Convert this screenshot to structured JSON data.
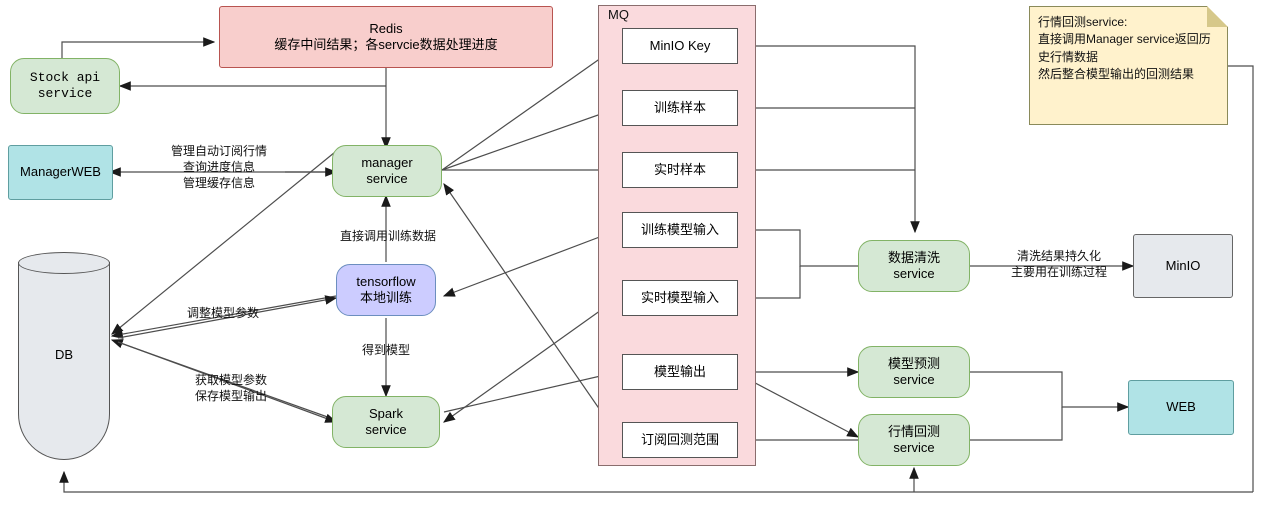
{
  "diagram": {
    "title": "Stock ML platform architecture",
    "colors": {
      "green": "#d5e8d4",
      "cyan": "#b0e3e6",
      "purple": "#ccccff",
      "pink": "#f8cecc",
      "mq_fill": "#fadadd",
      "grey": "#e6e9ed",
      "note": "#fff2cc",
      "stroke": "#666666"
    }
  },
  "nodes": {
    "redis": {
      "label": "Redis\n缓存中间结果；各servcie数据处理进度"
    },
    "stock_api": {
      "label": "Stock api\nservice"
    },
    "manager_web": {
      "label": "ManagerWEB"
    },
    "manager_service": {
      "label": "manager\nservice"
    },
    "db": {
      "label": "DB"
    },
    "tensorflow": {
      "label": "tensorflow\n本地训练"
    },
    "spark": {
      "label": "Spark\nservice"
    },
    "data_clean": {
      "label": "数据清洗\nservice"
    },
    "minio": {
      "label": "MinIO"
    },
    "model_predict": {
      "label": "模型预测\nservice"
    },
    "market_backtest": {
      "label": "行情回测\nservice"
    },
    "web": {
      "label": "WEB"
    }
  },
  "mq": {
    "title": "MQ",
    "queues": [
      {
        "label": "MinIO Key"
      },
      {
        "label": "训练样本"
      },
      {
        "label": "实时样本"
      },
      {
        "label": "训练模型输入"
      },
      {
        "label": "实时模型输入"
      },
      {
        "label": "模型输出"
      },
      {
        "label": "订阅回测范围"
      }
    ]
  },
  "note": {
    "text": "行情回测service:\n直接调用Manager service返回历史行情数据\n然后整合模型输出的回测结果"
  },
  "edge_labels": {
    "manager_web": "管理自动订阅行情\n查询进度信息\n管理缓存信息",
    "call_training_data": "直接调用训练数据",
    "adjust_model_params": "调整模型参数",
    "get_model": "得到模型",
    "fetch_save_model": "获取模型参数\n保存模型输出",
    "clean_persist": "清洗结果持久化\n主要用在训练过程"
  }
}
